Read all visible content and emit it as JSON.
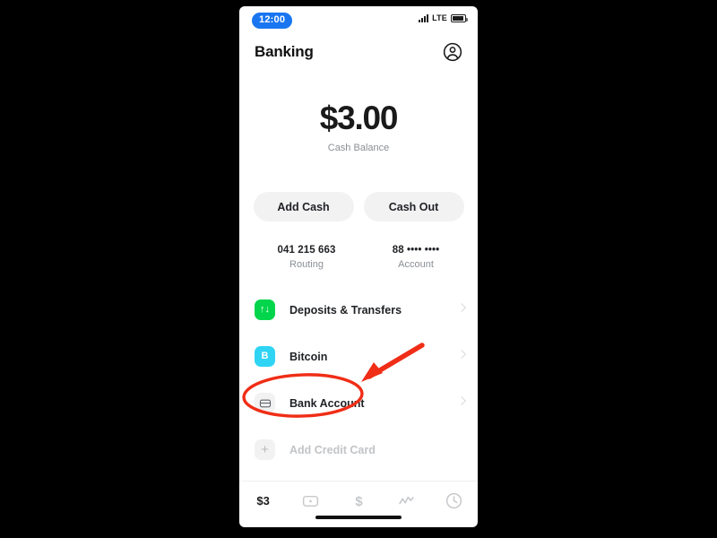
{
  "status_bar": {
    "time": "12:00",
    "network_label": "LTE",
    "signal_icon": "signal-bars-icon",
    "battery_icon": "battery-icon"
  },
  "header": {
    "title": "Banking",
    "profile_icon": "profile-avatar-icon"
  },
  "balance": {
    "amount": "$3.00",
    "label": "Cash Balance"
  },
  "actions": [
    {
      "label": "Add Cash",
      "name": "add-cash-button"
    },
    {
      "label": "Cash Out",
      "name": "cash-out-button"
    }
  ],
  "account_details": {
    "routing_value": "041 215 663",
    "routing_label": "Routing",
    "account_value": "88 •••• ••••",
    "account_label": "Account"
  },
  "list_rows": [
    {
      "label": "Deposits & Transfers",
      "icon": "transfer-arrows-icon",
      "glyph": "↑↓",
      "tile": "green",
      "chevron": true,
      "disabled": false
    },
    {
      "label": "Bitcoin",
      "icon": "bitcoin-icon",
      "glyph": "B",
      "tile": "cyan",
      "chevron": true,
      "disabled": false
    },
    {
      "label": "Bank Account",
      "icon": "bank-card-icon",
      "glyph": "",
      "tile": "grey",
      "chevron": true,
      "disabled": false
    },
    {
      "label": "Add Credit Card",
      "icon": "plus-icon",
      "glyph": "+",
      "tile": "grey",
      "chevron": false,
      "disabled": true
    }
  ],
  "tabs": [
    {
      "label": "$3",
      "name": "tab-banking",
      "icon": "balance-text",
      "active": true
    },
    {
      "label": "",
      "name": "tab-card",
      "icon": "card-icon",
      "active": false
    },
    {
      "label": "$",
      "name": "tab-payments",
      "icon": "dollar-icon",
      "active": false
    },
    {
      "label": "",
      "name": "tab-investing",
      "icon": "stock-chart-icon",
      "active": false
    },
    {
      "label": "",
      "name": "tab-activity",
      "icon": "clock-icon",
      "active": false
    }
  ],
  "annotation": {
    "highlight_color": "#F02D16",
    "ellipse_target": "Bank Account",
    "arrow_icon": "pointer-arrow-icon",
    "ellipse_icon": "highlight-ellipse-icon"
  },
  "colors": {
    "accent_blue": "#1976F0",
    "deposits_green": "#00D54B",
    "bitcoin_cyan": "#2FD4F5",
    "annotation_red": "#F02D16",
    "text_dark": "#1F2124",
    "text_muted": "#8B8F94"
  }
}
